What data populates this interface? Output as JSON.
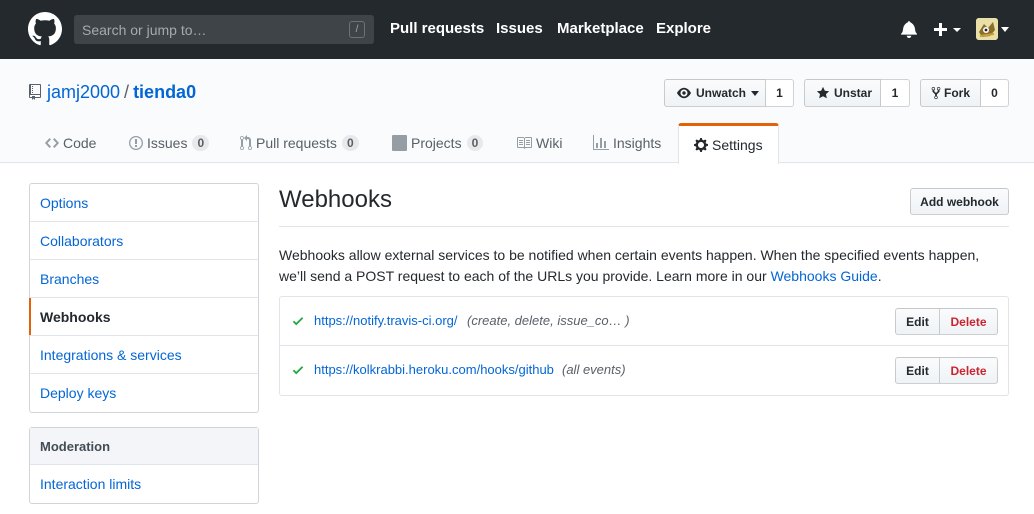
{
  "header": {
    "search_placeholder": "Search or jump to…",
    "search_key": "/",
    "nav": [
      "Pull requests",
      "Issues",
      "Marketplace",
      "Explore"
    ]
  },
  "repo": {
    "owner": "jamj2000",
    "separator": "/",
    "name": "tienda0",
    "watch_label": "Unwatch",
    "watch_count": "1",
    "star_label": "Unstar",
    "star_count": "1",
    "fork_label": "Fork",
    "fork_count": "0"
  },
  "tabs": [
    {
      "label": "Code",
      "icon": "code-icon"
    },
    {
      "label": "Issues",
      "count": "0",
      "icon": "issue-icon"
    },
    {
      "label": "Pull requests",
      "count": "0",
      "icon": "pull-request-icon"
    },
    {
      "label": "Projects",
      "count": "0",
      "icon": "project-icon"
    },
    {
      "label": "Wiki",
      "icon": "book-icon"
    },
    {
      "label": "Insights",
      "icon": "graph-icon"
    },
    {
      "label": "Settings",
      "icon": "gear-icon",
      "selected": true
    }
  ],
  "sidebar": {
    "items": [
      "Options",
      "Collaborators",
      "Branches",
      "Webhooks",
      "Integrations & services",
      "Deploy keys"
    ],
    "moderation_heading": "Moderation",
    "moderation_items": [
      "Interaction limits"
    ]
  },
  "main": {
    "title": "Webhooks",
    "add_button": "Add webhook",
    "description": "Webhooks allow external services to be notified when certain events happen. When the specified events happen, we’ll send a POST request to each of the URLs you provide. Learn more in our ",
    "guide_link": "Webhooks Guide",
    "description_end": ".",
    "hooks": [
      {
        "url": "https://notify.travis-ci.org/",
        "events": "(create, delete, issue_co…  )",
        "edit": "Edit",
        "delete": "Delete"
      },
      {
        "url": "https://kolkrabbi.heroku.com/hooks/github",
        "events": "(all events)",
        "edit": "Edit",
        "delete": "Delete"
      }
    ]
  },
  "colors": {
    "header_bg": "#24292e",
    "link": "#0366d6",
    "accent_orange": "#e36209",
    "success_green": "#28a745",
    "danger_red": "#cb2431"
  }
}
